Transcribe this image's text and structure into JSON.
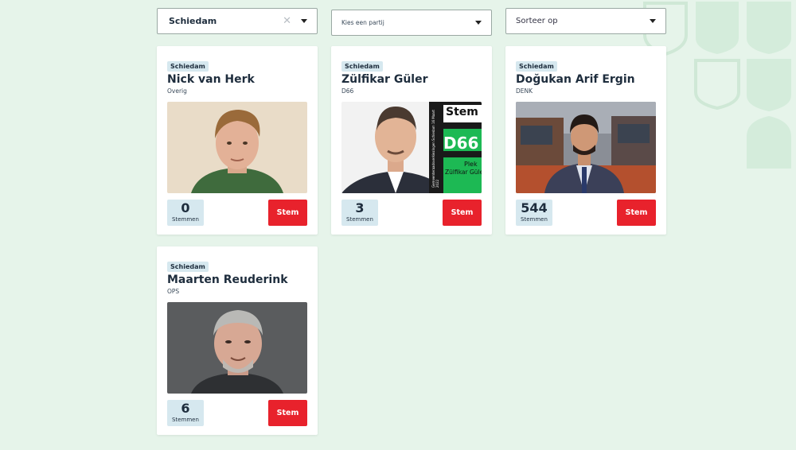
{
  "filters": {
    "city": {
      "value": "Schiedam",
      "clear": "✕"
    },
    "party": {
      "placeholder": "Kies een partij"
    },
    "sort": {
      "placeholder": "Sorteer op"
    }
  },
  "candidates": [
    {
      "city": "Schiedam",
      "name": "Nick van Herk",
      "party": "Overig",
      "votes": "0",
      "votes_label": "Stemmen",
      "vote_button": "Stem"
    },
    {
      "city": "Schiedam",
      "name": "Zülfikar Güler",
      "party": "D66",
      "votes": "3",
      "votes_label": "Stemmen",
      "vote_button": "Stem",
      "poster": {
        "top": "Stem",
        "party": "D66",
        "side": "Gemeenteraadsverkiezingen Schiedam 16 Maart 2022",
        "plek": "Plek",
        "person": "Zülfikar Güle"
      }
    },
    {
      "city": "Schiedam",
      "name": "Doğukan Arif Ergin",
      "party": "DENK",
      "votes": "544",
      "votes_label": "Stemmen",
      "vote_button": "Stem"
    },
    {
      "city": "Schiedam",
      "name": "Maarten Reuderink",
      "party": "OPS",
      "votes": "6",
      "votes_label": "Stemmen",
      "vote_button": "Stem"
    }
  ],
  "colors": {
    "background": "#e6f4ea",
    "accent_red": "#e8222c",
    "badge_blue": "#d6e8ef",
    "d66_green": "#1db954"
  }
}
